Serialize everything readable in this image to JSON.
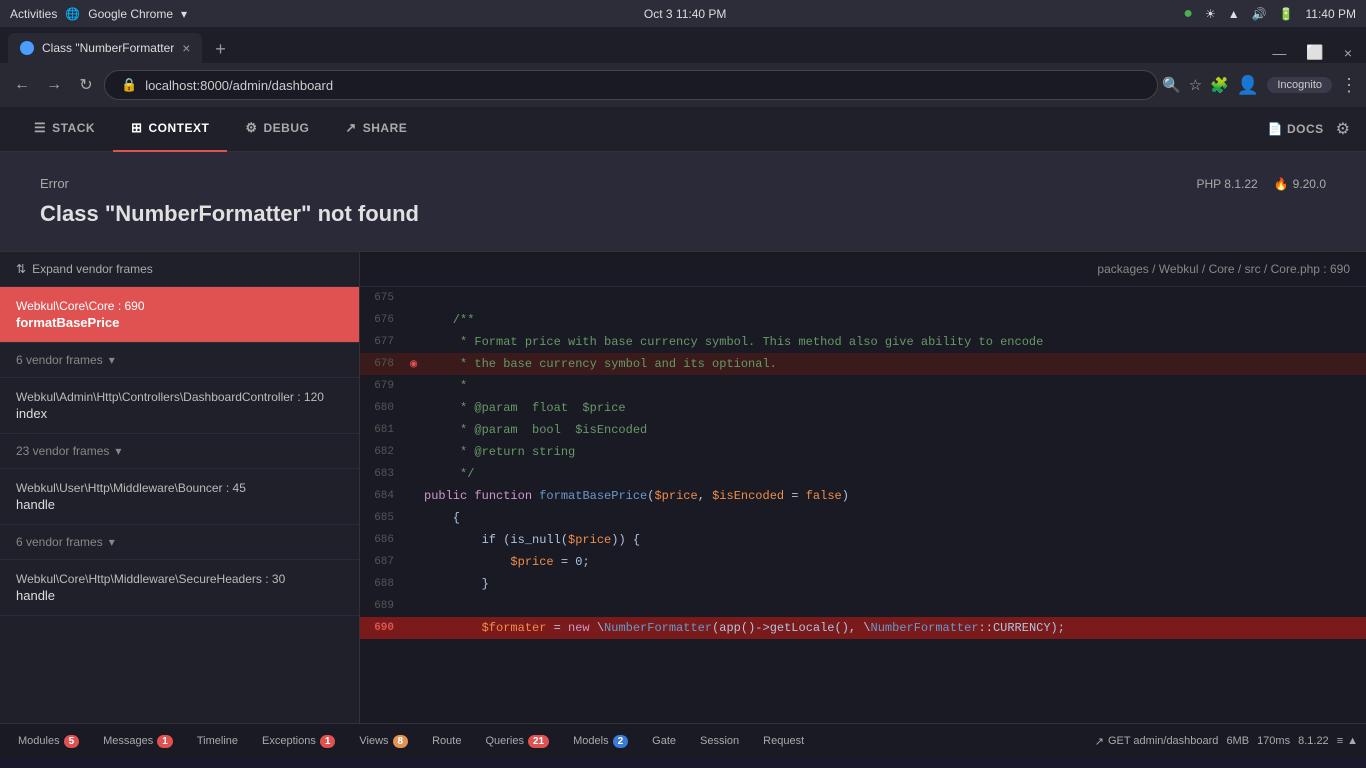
{
  "os": {
    "left": "Activities",
    "app": "Google Chrome",
    "datetime": "Oct 3  11:40 PM",
    "notification_icon": "🔔"
  },
  "browser": {
    "tab_title": "Class \"NumberFormatter",
    "tab_favicon": "bug",
    "address": "localhost:8000/admin/dashboard",
    "incognito_label": "Incognito",
    "nav": {
      "back": "←",
      "forward": "→",
      "refresh": "↺"
    }
  },
  "toolbar": {
    "tabs": [
      {
        "id": "stack",
        "label": "STACK",
        "icon": "☰",
        "active": false
      },
      {
        "id": "context",
        "label": "CONTEXT",
        "icon": "⊞",
        "active": true
      },
      {
        "id": "debug",
        "label": "DEBUG",
        "icon": "⚙",
        "active": false
      },
      {
        "id": "share",
        "label": "SHARE",
        "icon": "↗",
        "active": false
      }
    ],
    "docs_label": "DOCS",
    "settings_icon": "⚙"
  },
  "error": {
    "label": "Error",
    "title": "Class \"NumberFormatter\" not found",
    "php_version": "PHP 8.1.22",
    "ignition_version": "9.20.0"
  },
  "stack": {
    "expand_vendor_label": "Expand vendor frames",
    "frames": [
      {
        "class": "Webkul\\Core\\Core : 690",
        "method": "formatBasePrice",
        "active": true
      },
      {
        "class": "Webkul\\Admin\\Http\\Controllers\\DashboardController : 120",
        "method": "index",
        "active": false
      }
    ],
    "vendor_groups": [
      {
        "label": "6 vendor frames",
        "count": 6
      },
      {
        "label": "23 vendor frames",
        "count": 23
      },
      {
        "label": "6 vendor frames",
        "count": 6
      }
    ],
    "middleware_frames": [
      {
        "class": "Webkul\\User\\Http\\Middleware\\Bouncer : 45",
        "method": "handle"
      },
      {
        "class": "Webkul\\Core\\Http\\Middleware\\SecureHeaders : 30",
        "method": "handle"
      }
    ]
  },
  "code": {
    "file_path": "packages / Webkul / Core / src / Core.php : 690",
    "lines": [
      {
        "num": 675,
        "code": "",
        "highlighted": false,
        "current": false,
        "arrow": false
      },
      {
        "num": 676,
        "code": "    /**",
        "highlighted": false,
        "current": false,
        "arrow": false
      },
      {
        "num": 677,
        "code": "     * Format price with base currency symbol. This method also give ability to encode",
        "highlighted": false,
        "current": false,
        "arrow": false
      },
      {
        "num": 678,
        "code": "     * the base currency symbol and its optional.",
        "highlighted": true,
        "current": false,
        "arrow": true
      },
      {
        "num": 679,
        "code": "     *",
        "highlighted": false,
        "current": false,
        "arrow": false
      },
      {
        "num": 680,
        "code": "     * @param  float  $price",
        "highlighted": false,
        "current": false,
        "arrow": false
      },
      {
        "num": 681,
        "code": "     * @param  bool  $isEncoded",
        "highlighted": false,
        "current": false,
        "arrow": false
      },
      {
        "num": 682,
        "code": "     * @return string",
        "highlighted": false,
        "current": false,
        "arrow": false
      },
      {
        "num": 683,
        "code": "     */",
        "highlighted": false,
        "current": false,
        "arrow": false
      },
      {
        "num": 684,
        "code": "    public function formatBasePrice($price, $isEncoded = false)",
        "highlighted": false,
        "current": false,
        "arrow": false
      },
      {
        "num": 685,
        "code": "    {",
        "highlighted": false,
        "current": false,
        "arrow": false
      },
      {
        "num": 686,
        "code": "        if (is_null($price)) {",
        "highlighted": false,
        "current": false,
        "arrow": false
      },
      {
        "num": 687,
        "code": "            $price = 0;",
        "highlighted": false,
        "current": false,
        "arrow": false
      },
      {
        "num": 688,
        "code": "        }",
        "highlighted": false,
        "current": false,
        "arrow": false
      },
      {
        "num": 689,
        "code": "",
        "highlighted": false,
        "current": false,
        "arrow": false
      },
      {
        "num": 690,
        "code": "        $formater = new \\NumberFormatter(app()->getLocale(), \\NumberFormatter::CURRENCY);",
        "highlighted": false,
        "current": true,
        "arrow": false
      }
    ]
  },
  "bottom_bar": {
    "items": [
      {
        "id": "modules",
        "label": "Modules",
        "badge": "5",
        "badge_color": "red"
      },
      {
        "id": "messages",
        "label": "Messages",
        "badge": "1",
        "badge_color": "red"
      },
      {
        "id": "timeline",
        "label": "Timeline",
        "badge": null
      },
      {
        "id": "exceptions",
        "label": "Exceptions",
        "badge": "1",
        "badge_color": "red"
      },
      {
        "id": "views",
        "label": "Views",
        "badge": "8",
        "badge_color": "orange"
      },
      {
        "id": "route",
        "label": "Route",
        "badge": null
      },
      {
        "id": "queries",
        "label": "Queries",
        "badge": "21",
        "badge_color": "red"
      },
      {
        "id": "models",
        "label": "Models",
        "badge": "2",
        "badge_color": "blue"
      },
      {
        "id": "gate",
        "label": "Gate",
        "badge": null
      },
      {
        "id": "session",
        "label": "Session",
        "badge": null
      },
      {
        "id": "request",
        "label": "Request",
        "badge": null
      }
    ],
    "right": {
      "route": "GET admin/dashboard",
      "memory": "6MB",
      "time": "170ms",
      "php": "8.1.22"
    }
  }
}
